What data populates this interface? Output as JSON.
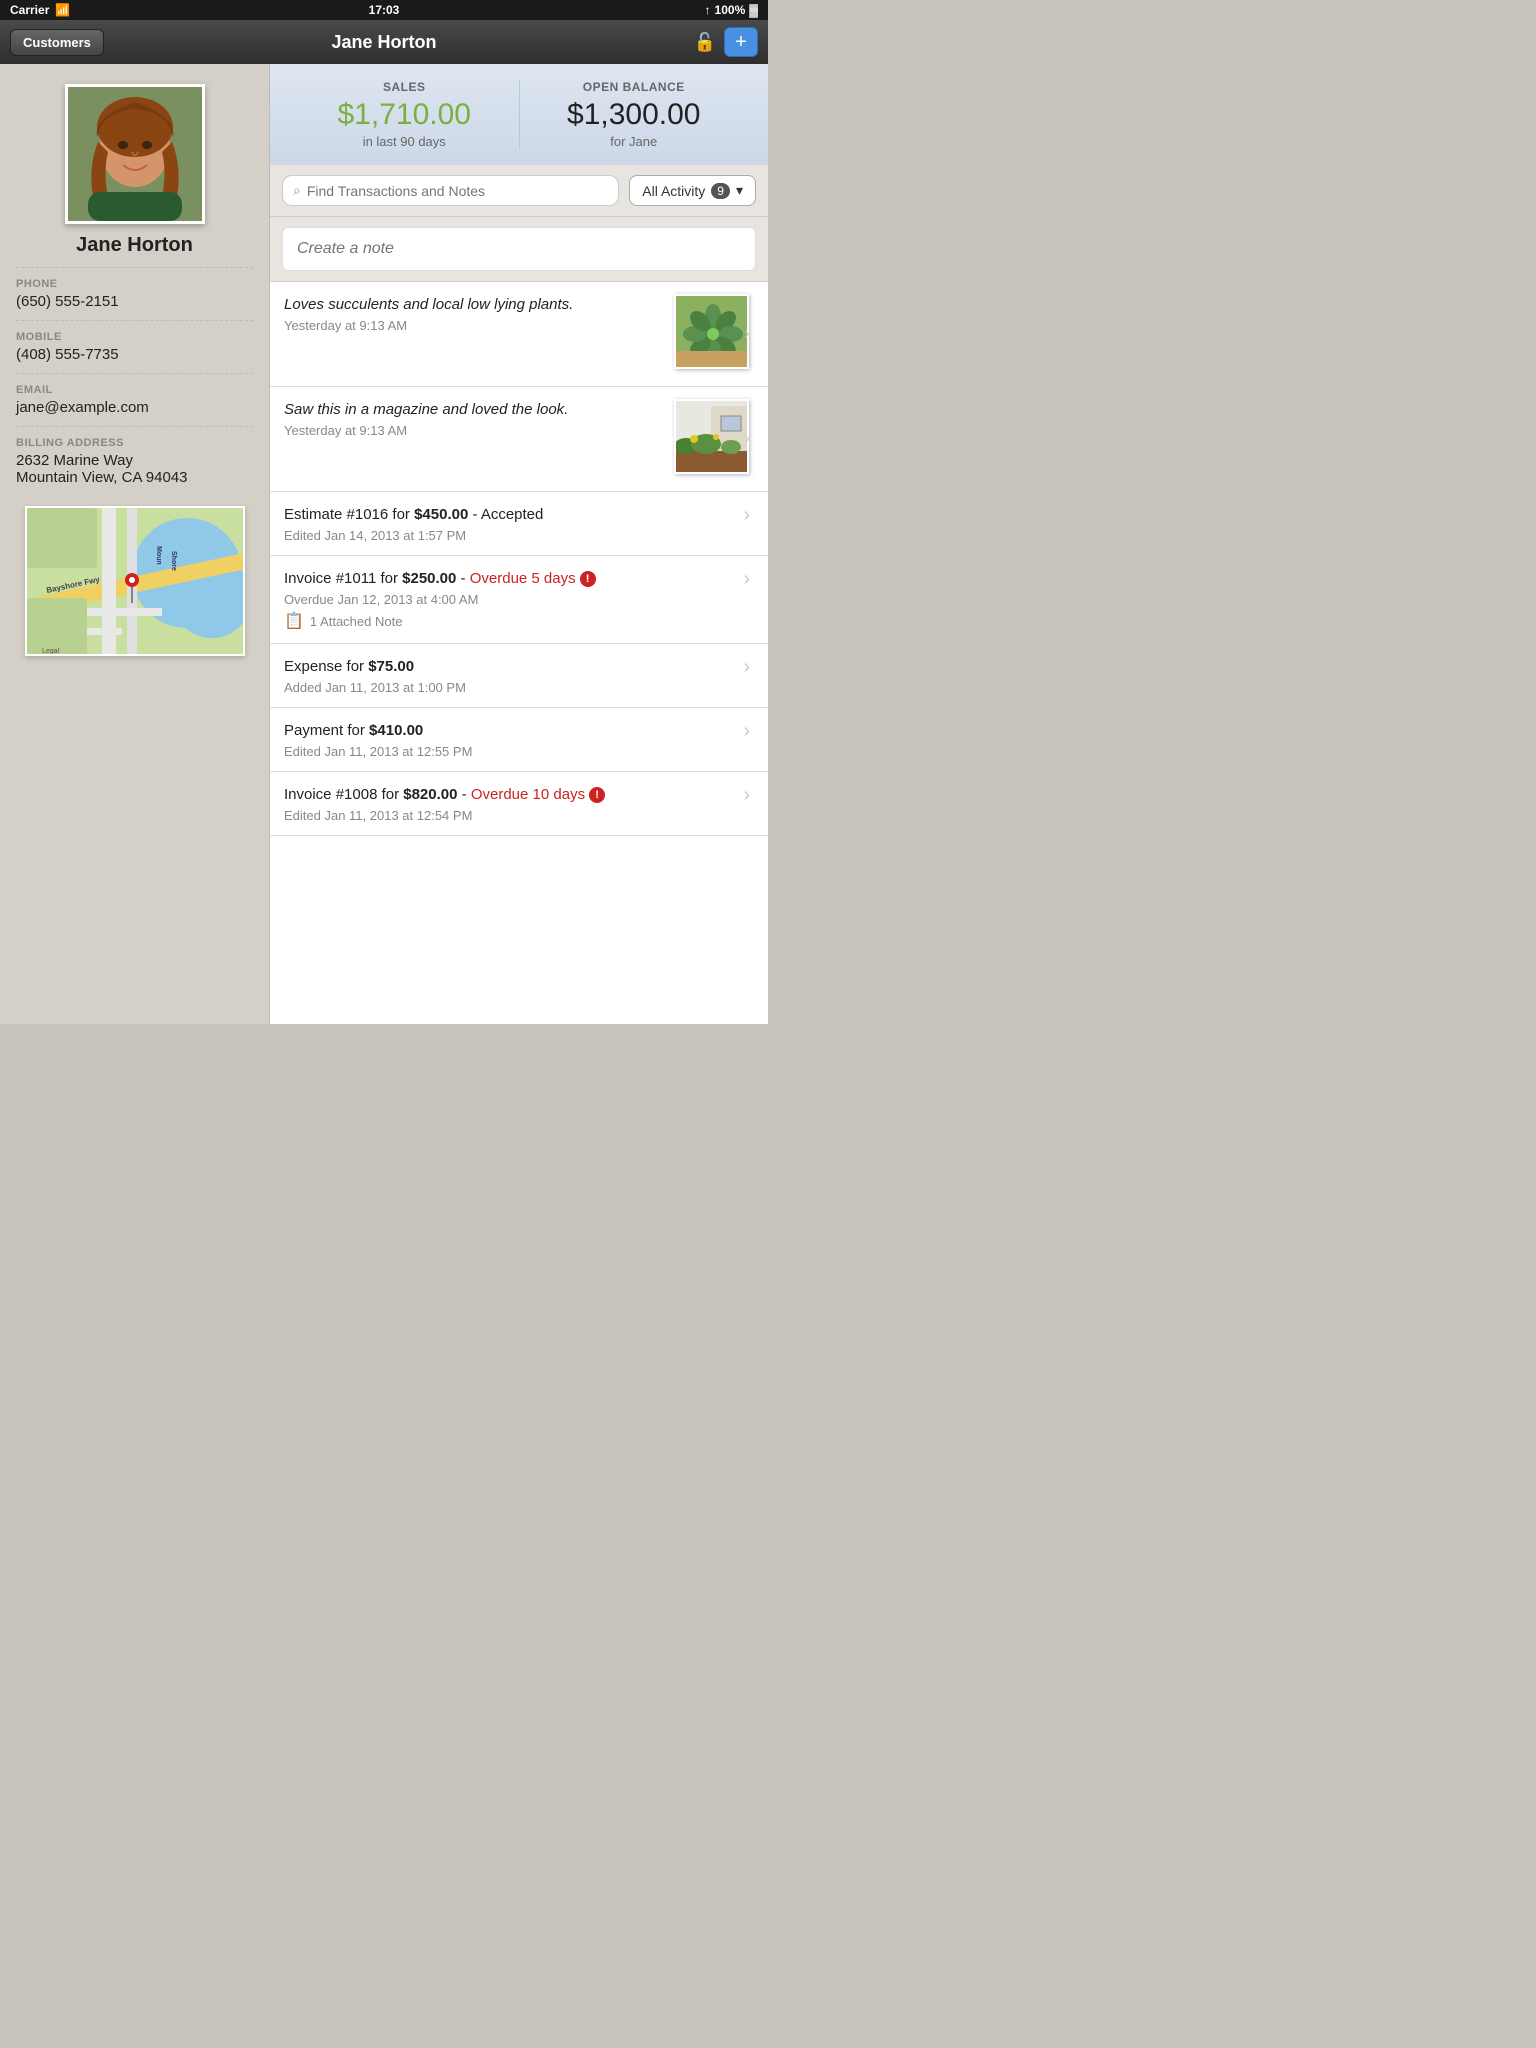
{
  "statusBar": {
    "carrier": "Carrier",
    "time": "17:03",
    "battery": "100%",
    "wifi": true
  },
  "navBar": {
    "backLabel": "Customers",
    "title": "Jane Horton",
    "addLabel": "+"
  },
  "sidebar": {
    "customerName": "Jane Horton",
    "phone": {
      "label": "PHONE",
      "value": "(650) 555-2151"
    },
    "mobile": {
      "label": "MOBILE",
      "value": "(408) 555-7735"
    },
    "email": {
      "label": "EMAIL",
      "value": "jane@example.com"
    },
    "billingAddress": {
      "label": "BILLING ADDRESS",
      "line1": "2632 Marine Way",
      "line2": "Mountain View, CA 94043"
    },
    "mapLabels": [
      "Moun Shore",
      "Legal",
      "Bayshore Fwy"
    ]
  },
  "stats": {
    "sales": {
      "label": "SALES",
      "amount": "$1,710.00",
      "sub": "in last 90 days"
    },
    "openBalance": {
      "label": "OPEN BALANCE",
      "amount": "$1,300.00",
      "sub": "for Jane"
    }
  },
  "searchBar": {
    "placeholder": "Find Transactions and Notes",
    "filterLabel": "All Activity",
    "filterCount": "9"
  },
  "createNote": {
    "placeholder": "Create a note"
  },
  "activities": [
    {
      "id": "note-1",
      "type": "note",
      "titleItalic": "Loves succulents and local low lying plants.",
      "subtitle": "Yesterday at 9:13 AM",
      "hasThumb": true,
      "thumbType": "succulent"
    },
    {
      "id": "note-2",
      "type": "note",
      "titleItalic": "Saw this in a magazine and loved the look.",
      "subtitle": "Yesterday at 9:13 AM",
      "hasThumb": true,
      "thumbType": "garden"
    },
    {
      "id": "estimate-1",
      "type": "estimate",
      "titlePrefix": "Estimate #1016 for ",
      "titleBold": "$450.00",
      "titleSuffix": " - Accepted",
      "subtitle": "Edited Jan 14, 2013 at 1:57 PM",
      "hasThumb": false
    },
    {
      "id": "invoice-1",
      "type": "invoice",
      "titlePrefix": "Invoice #1011 for ",
      "titleBold": "$250.00",
      "titleSuffix": " - ",
      "overdue": "Overdue 5 days",
      "overdueIcon": "!",
      "subtitle": "Overdue Jan 12, 2013 at 4:00 AM",
      "noteCount": "1",
      "noteLabel": "Attached Note",
      "hasThumb": false
    },
    {
      "id": "expense-1",
      "type": "expense",
      "titlePrefix": "Expense for ",
      "titleBold": "$75.00",
      "titleSuffix": "",
      "subtitle": "Added Jan 11, 2013 at 1:00 PM",
      "hasThumb": false
    },
    {
      "id": "payment-1",
      "type": "payment",
      "titlePrefix": "Payment for ",
      "titleBold": "$410.00",
      "titleSuffix": "",
      "subtitle": "Edited Jan 11, 2013 at 12:55 PM",
      "hasThumb": false
    },
    {
      "id": "invoice-2",
      "type": "invoice",
      "titlePrefix": "Invoice #1008 for ",
      "titleBold": "$820.00",
      "titleSuffix": " - ",
      "overdue": "Overdue 10 days",
      "overdueIcon": "!",
      "subtitle": "Edited Jan 11, 2013 at 12:54 PM",
      "hasThumb": false
    }
  ]
}
